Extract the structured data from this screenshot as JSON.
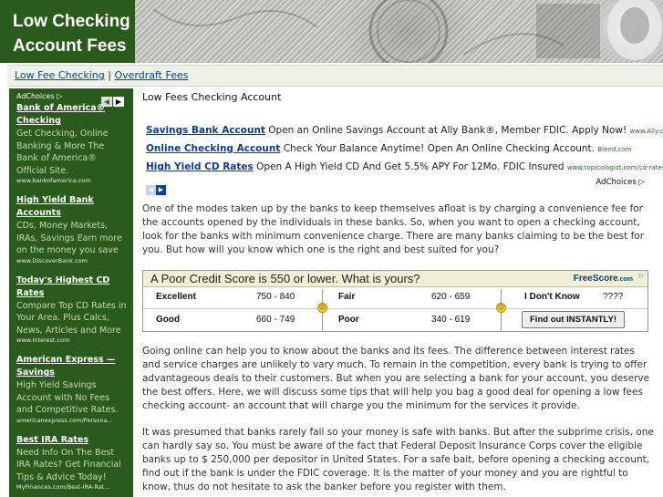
{
  "header": {
    "title_line1": "Low Checking",
    "title_line2": "Account Fees"
  },
  "nav": {
    "link1": "Low Fee Checking",
    "separator": "|",
    "link2": "Overdraft Fees"
  },
  "sidebar": {
    "adchoices": "AdChoices",
    "ads": [
      {
        "title": "Bank of America® Checking",
        "body": "Get Checking, Online Banking & More The Bank of America® Official Site.",
        "url": "www.bankofamerica.com"
      },
      {
        "title": "High Yield Bank Accounts",
        "body": "CDs, Money Markets, IRAs, Savings Earn more on the money you save",
        "url": "www.DiscoverBank.com"
      },
      {
        "title": "Today's Highest CD Rates",
        "body": "Compare Top CD Rates in Your Area. Plus Calcs, News, Articles and More",
        "url": "www.Interest.com"
      },
      {
        "title": "American Express —Savings",
        "body": "High Yield Savings Account with No Fees and Competitive Rates.",
        "url": "americanexpress.com/Persona..."
      },
      {
        "title": "Best IRA Rates",
        "body": "Need Info On The Best IRA Rates? Get Financial Tips & Advice Today!",
        "url": "MyFinances.com/Best-IRA-Rat..."
      }
    ]
  },
  "main": {
    "title": "Low Fees Checking Account",
    "top_ads": [
      {
        "link": "Savings Bank Account",
        "text": " Open an Online Savings Account at Ally Bank®, Member FDIC. Apply Now! ",
        "url": "www.Ally.com"
      },
      {
        "link": "Online Checking Account",
        "text": " Check Your Balance Anytime! Open An Online Checking Account. ",
        "url": "Blend.com"
      },
      {
        "link": "High Yield CD Rates",
        "text": " Open A High Yield CD And Get 5.5% APY For 12Mo. FDIC Insured ",
        "url": "www.topicologist.com/cd-rates"
      }
    ],
    "top_adchoices": "AdChoices",
    "para1": "One of the modes taken up by the banks to keep themselves afloat is by charging a convenience fee for the accounts opened by the individuals in these banks. So, when you want to open a checking account, look for the banks with minimum convenience charge. There are many banks claiming to be the best for you. But how will you know which one is the right and best suited for you?",
    "para2": "Going online can help you to know about the banks and its fees. The difference between interest rates and service charges are unlikely to vary much. To remain in the competition, every bank is trying to offer advantageous deals to their customers. But when you are selecting a bank for your account, you deserve the best offers. Here, we will discuss some tips that will help you bag a good deal for opening a low fees checking account- an account that will charge you the minimum for the services it provide.",
    "para3": "It was presumed that banks rarely fail so your money is safe with banks. But after the subprime crisis, one can hardly say so. You must be aware of the fact that Federal Deposit Insurance Corps cover the eligible banks up to $ 250,000 per depositor in United States. For a safe bait, before opening a checking account, find out if the bank is under the FDIC coverage. It is the matter of your money and you are rightful to know, thus do not hesitate to ask the banker before you register with them."
  },
  "credit_widget": {
    "question": "A Poor Credit Score is 550 or lower. What is yours?",
    "logo": "FreeScore",
    "logo_ext": ".com",
    "rows": {
      "excellent_label": "Excellent",
      "excellent_range": "750 - 840",
      "fair_label": "Fair",
      "fair_range": "620 - 659",
      "dontknow_label": "I Don't Know",
      "dontknow_value": "????",
      "good_label": "Good",
      "good_range": "660 - 749",
      "poor_label": "Poor",
      "poor_range": "340 - 619"
    },
    "button": "Find out INSTANTLY!"
  }
}
